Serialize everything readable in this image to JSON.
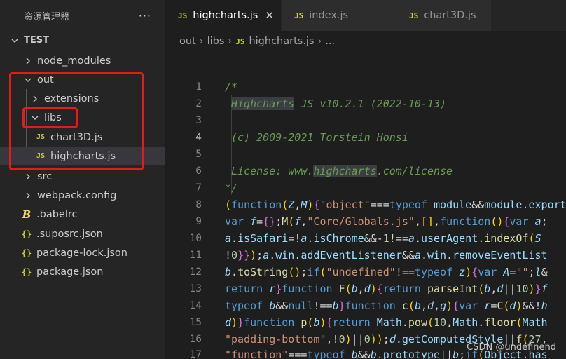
{
  "explorer": {
    "title": "资源管理器",
    "more": "···",
    "root": "TEST",
    "items": [
      {
        "label": "node_modules"
      },
      {
        "label": "out"
      },
      {
        "label": "extensions"
      },
      {
        "label": "libs"
      },
      {
        "label": "chart3D.js",
        "badge": "JS"
      },
      {
        "label": "highcharts.js",
        "badge": "JS"
      },
      {
        "label": "src"
      },
      {
        "label": "webpack.config"
      },
      {
        "label": ".babelrc",
        "badge": "B"
      },
      {
        "label": ".suposrc.json",
        "badge": "{}"
      },
      {
        "label": "package-lock.json",
        "badge": "{}"
      },
      {
        "label": "package.json",
        "badge": "{}"
      }
    ]
  },
  "tabs": [
    {
      "label": "highcharts.js",
      "badge": "JS",
      "close": "✕"
    },
    {
      "label": "index.js",
      "badge": "JS"
    },
    {
      "label": "chart3D.js",
      "badge": "JS"
    }
  ],
  "breadcrumb": {
    "a": "out",
    "b": "libs",
    "c": "highcharts.js",
    "d": "...",
    "badge": "JS",
    "sep": "›"
  },
  "code": {
    "numbers": [
      "1",
      "2",
      "3",
      "4",
      "5",
      "6",
      "7",
      "8",
      "9",
      "10",
      "11",
      "12",
      "13",
      "14",
      "15",
      "16",
      "17"
    ],
    "l1": "/*",
    "l2a": "Highcharts",
    "l2b": " JS v10.2.1 (2022-10-13)",
    "l4": "(c) 2009-2021 Torstein Honsi",
    "l6a": "License: www.",
    "l6b": "highcharts",
    "l6c": ".com/license",
    "l7": "*/",
    "l8": "(function(Z,M){\"object\"===typeof module&&module.exports",
    "l9": "var f={};M(f,\"Core/Globals.js\",[],function(){var a;",
    "l10": "a.isSafari=!a.isChrome&&-1!==a.userAgent.indexOf(\"S",
    "l11": "!0}});a.win.addEventListener&&a.win.removeEventList",
    "l12": "b.toString();if(\"undefined\"!==typeof z){var A=\"\";l&",
    "l13": "return r}function F(b,d){return parseInt(b,d||10)}f",
    "l14": "typeof b&&null!==b}function c(b,d,g){var r=C(d)&&!h",
    "l15": "d)}function p(b){return Math.pow(10,Math.floor(Math",
    "l16": "\"padding-bottom\",!0)||0));d.getComputedStyle||f(27,",
    "l17": "\"function\"===typeof b&&b.prototype||b;if(Object.has"
  },
  "watermark": "CSDN @undefinend",
  "colors": {
    "annotation": "#e51a1a",
    "accent": "#cbcb41"
  }
}
